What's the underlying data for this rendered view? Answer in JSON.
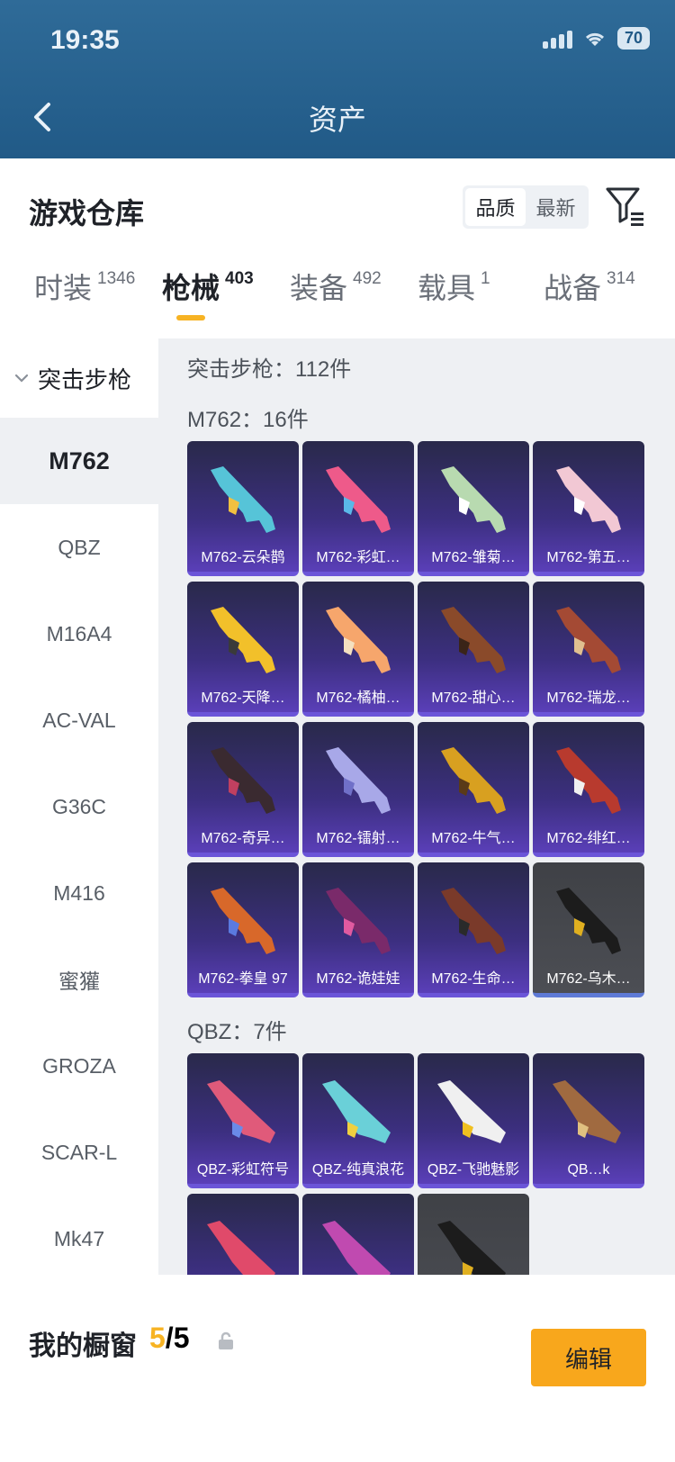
{
  "status": {
    "time": "19:35",
    "battery": "70"
  },
  "nav": {
    "title": "资产"
  },
  "warehouse": {
    "title": "游戏仓库",
    "sort_options": [
      "品质",
      "最新"
    ],
    "sort_selected": "品质"
  },
  "tabs": [
    {
      "label": "时装",
      "count": "1346"
    },
    {
      "label": "枪械",
      "count": "403"
    },
    {
      "label": "装备",
      "count": "492"
    },
    {
      "label": "载具",
      "count": "1"
    },
    {
      "label": "战备",
      "count": "314"
    }
  ],
  "active_tab": "枪械",
  "sidebar": {
    "group": "突击步枪",
    "items": [
      "M762",
      "QBZ",
      "M16A4",
      "AC-VAL",
      "G36C",
      "M416",
      "蜜獾",
      "GROZA",
      "SCAR-L",
      "Mk47"
    ],
    "active": "M762"
  },
  "content": {
    "category_total": "突击步枪：112件",
    "sections": [
      {
        "title": "M762：16件",
        "items": [
          {
            "name": "M762-云朵鹊"
          },
          {
            "name": "M762-彩虹…"
          },
          {
            "name": "M762-雏菊…"
          },
          {
            "name": "M762-第五…"
          },
          {
            "name": "M762-天降…"
          },
          {
            "name": "M762-橘柚…"
          },
          {
            "name": "M762-甜心…"
          },
          {
            "name": "M762-瑞龙…"
          },
          {
            "name": "M762-奇异…"
          },
          {
            "name": "M762-镭射…"
          },
          {
            "name": "M762-牛气…"
          },
          {
            "name": "M762-绯红…"
          },
          {
            "name": "M762-拳皇 97"
          },
          {
            "name": "M762-诡娃娃"
          },
          {
            "name": "M762-生命…"
          },
          {
            "name": "M762-乌木…"
          }
        ]
      },
      {
        "title": "QBZ：7件",
        "items": [
          {
            "name": "QBZ-彩虹符号"
          },
          {
            "name": "QBZ-纯真浪花"
          },
          {
            "name": "QBZ-飞驰魅影"
          },
          {
            "name": "QB…k"
          },
          {
            "name": ""
          },
          {
            "name": ""
          },
          {
            "name": ""
          }
        ]
      }
    ]
  },
  "showcase": {
    "label": "我的橱窗",
    "used": "5",
    "total": "/5",
    "edit": "编辑"
  },
  "colors": {
    "accent": "#f7b323",
    "header": "#2f6b98",
    "card": "#3c2f80"
  }
}
